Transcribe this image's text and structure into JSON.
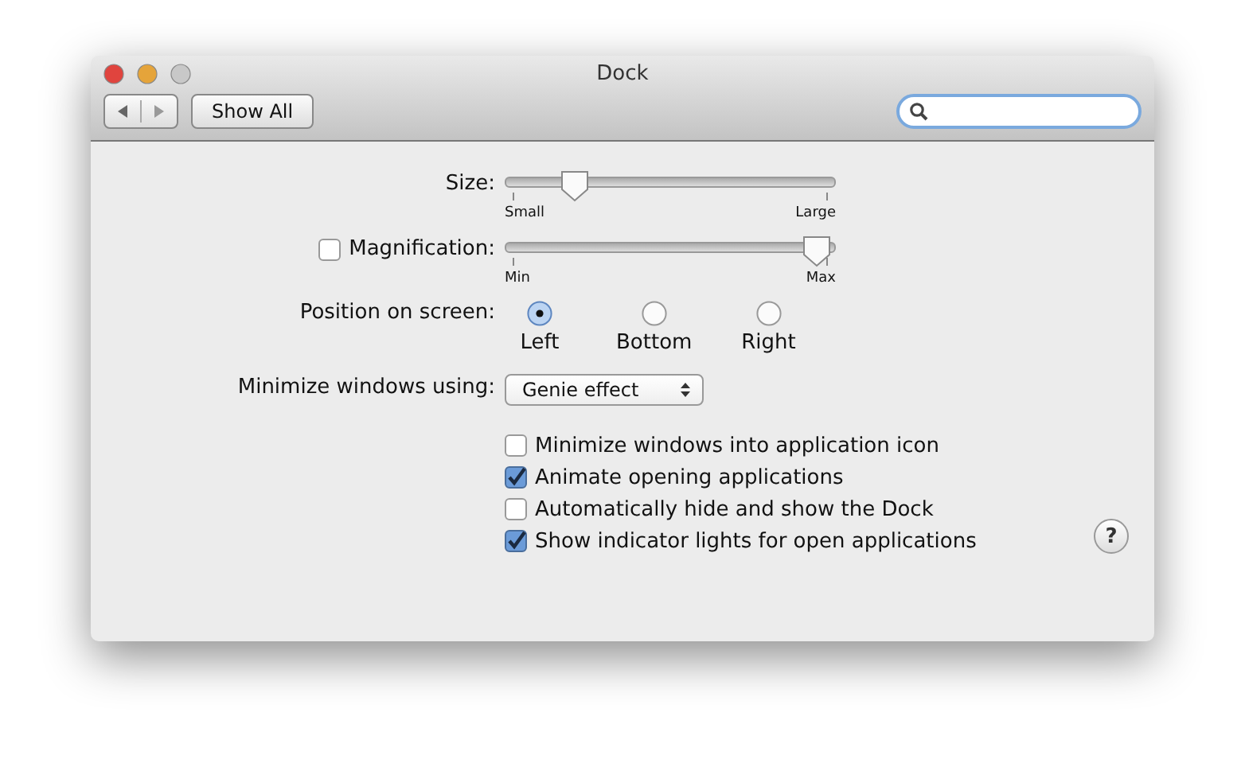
{
  "window": {
    "title": "Dock"
  },
  "toolbar": {
    "show_all": "Show All"
  },
  "size": {
    "label": "Size:",
    "level": 0.2,
    "min_label": "Small",
    "max_label": "Large"
  },
  "magnification": {
    "label": "Magnification:",
    "checked": false,
    "level": 0.96,
    "min_label": "Min",
    "max_label": "Max"
  },
  "position": {
    "label": "Position on screen:",
    "options": [
      {
        "label": "Left",
        "selected": true
      },
      {
        "label": "Bottom",
        "selected": false
      },
      {
        "label": "Right",
        "selected": false
      }
    ]
  },
  "minimize": {
    "label": "Minimize windows using:",
    "value": "Genie effect"
  },
  "options": [
    {
      "label": "Minimize windows into application icon",
      "checked": false
    },
    {
      "label": "Animate opening applications",
      "checked": true
    },
    {
      "label": "Automatically hide and show the Dock",
      "checked": false
    },
    {
      "label": "Show indicator lights for open applications",
      "checked": true
    }
  ],
  "help": "?"
}
